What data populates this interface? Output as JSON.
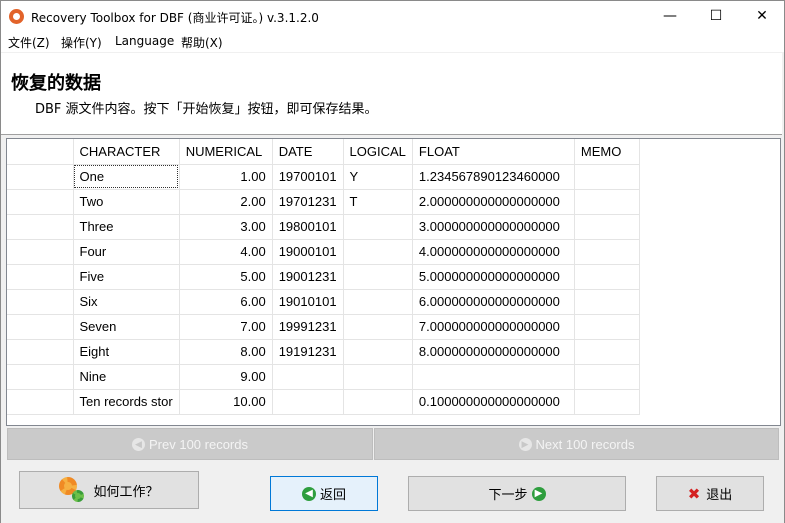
{
  "window": {
    "title": "Recovery Toolbox for DBF (商业许可证。) v.3.1.2.0",
    "minimize": "—",
    "maximize": "☐",
    "close": "✕"
  },
  "menu": [
    "文件(Z)",
    "操作(Y)",
    "Language",
    "帮助(X)"
  ],
  "header": {
    "title": "恢复的数据",
    "subtitle": "DBF 源文件内容。按下「开始恢复」按钮，即可保存结果。"
  },
  "table": {
    "columns": [
      "",
      "CHARACTER",
      "NUMERICAL",
      "DATE",
      "LOGICAL",
      "FLOAT",
      "MEMO"
    ],
    "rows": [
      [
        "",
        "One",
        "1.00",
        "19700101",
        "Y",
        "1.234567890123460000",
        ""
      ],
      [
        "",
        "Two",
        "2.00",
        "19701231",
        "T",
        "2.000000000000000000",
        ""
      ],
      [
        "",
        "Three",
        "3.00",
        "19800101",
        "",
        "3.000000000000000000",
        ""
      ],
      [
        "",
        "Four",
        "4.00",
        "19000101",
        "",
        "4.000000000000000000",
        ""
      ],
      [
        "",
        "Five",
        "5.00",
        "19001231",
        "",
        "5.000000000000000000",
        ""
      ],
      [
        "",
        "Six",
        "6.00",
        "19010101",
        "",
        "6.000000000000000000",
        ""
      ],
      [
        "",
        "Seven",
        "7.00",
        "19991231",
        "",
        "7.000000000000000000",
        ""
      ],
      [
        "",
        "Eight",
        "8.00",
        "19191231",
        "",
        "8.000000000000000000",
        ""
      ],
      [
        "",
        "Nine",
        "9.00",
        "",
        "",
        "",
        ""
      ],
      [
        "",
        "Ten records stor",
        "10.00",
        "",
        "",
        "0.100000000000000000",
        ""
      ]
    ]
  },
  "pager": {
    "prev": "Prev 100 records",
    "next": "Next 100 records"
  },
  "buttons": {
    "how_it_works": "如何工作？",
    "back": "返回",
    "next": "下一步",
    "exit": "退出"
  },
  "icons": {
    "app": "recovery-toolbox-icon",
    "how": "gears-icon",
    "back": "arrow-left-icon",
    "next": "arrow-right-icon",
    "exit": "red-x-icon"
  },
  "colors": {
    "accent_green": "#2e9e3e",
    "exit_red": "#d42020",
    "focus_blue": "#0078d7",
    "disabled_gray": "#cacaca"
  }
}
